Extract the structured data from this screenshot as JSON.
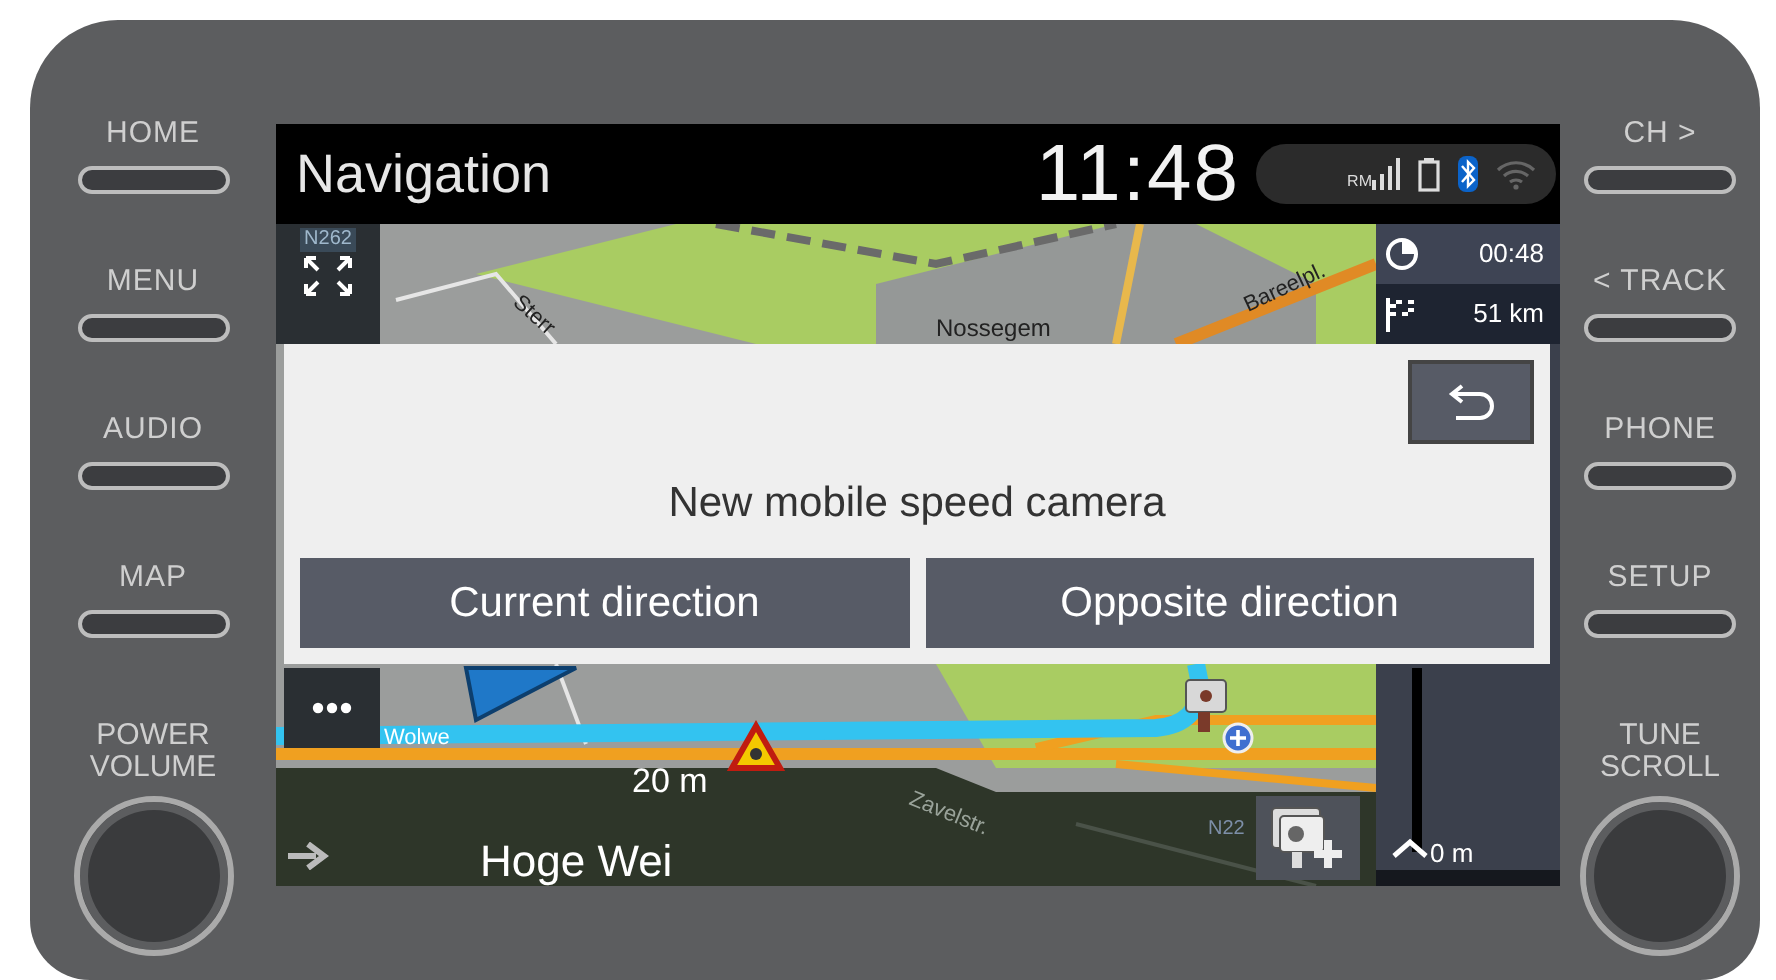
{
  "left_keys": [
    {
      "label": "HOME",
      "kind": "key"
    },
    {
      "label": "MENU",
      "kind": "key"
    },
    {
      "label": "AUDIO",
      "kind": "key"
    },
    {
      "label": "MAP",
      "kind": "key"
    },
    {
      "label": "POWER VOLUME",
      "kind": "knob"
    }
  ],
  "header": {
    "title": "Navigation",
    "clock": "11:48",
    "signal_label": "RM"
  },
  "map": {
    "labels": [
      "N262",
      "Sterr",
      "Nossegem",
      "Bareelpl.",
      "Wolwe",
      "Zavelstr.",
      "N22"
    ]
  },
  "trip": {
    "time": "00:48",
    "distance": "51 km"
  },
  "distance_scale": {
    "reading": "0 m"
  },
  "dialog": {
    "message": "New mobile speed camera",
    "options": [
      "Current direction",
      "Opposite direction"
    ]
  },
  "guidance": {
    "distance": "20 m",
    "street": "Hoge Wei"
  },
  "right_keys": [
    {
      "label": "CH >",
      "kind": "key"
    },
    {
      "label": "< TRACK",
      "kind": "key"
    },
    {
      "label": "PHONE",
      "kind": "key"
    },
    {
      "label": "SETUP",
      "kind": "key"
    },
    {
      "label": "TUNE SCROLL",
      "kind": "knob"
    }
  ]
}
